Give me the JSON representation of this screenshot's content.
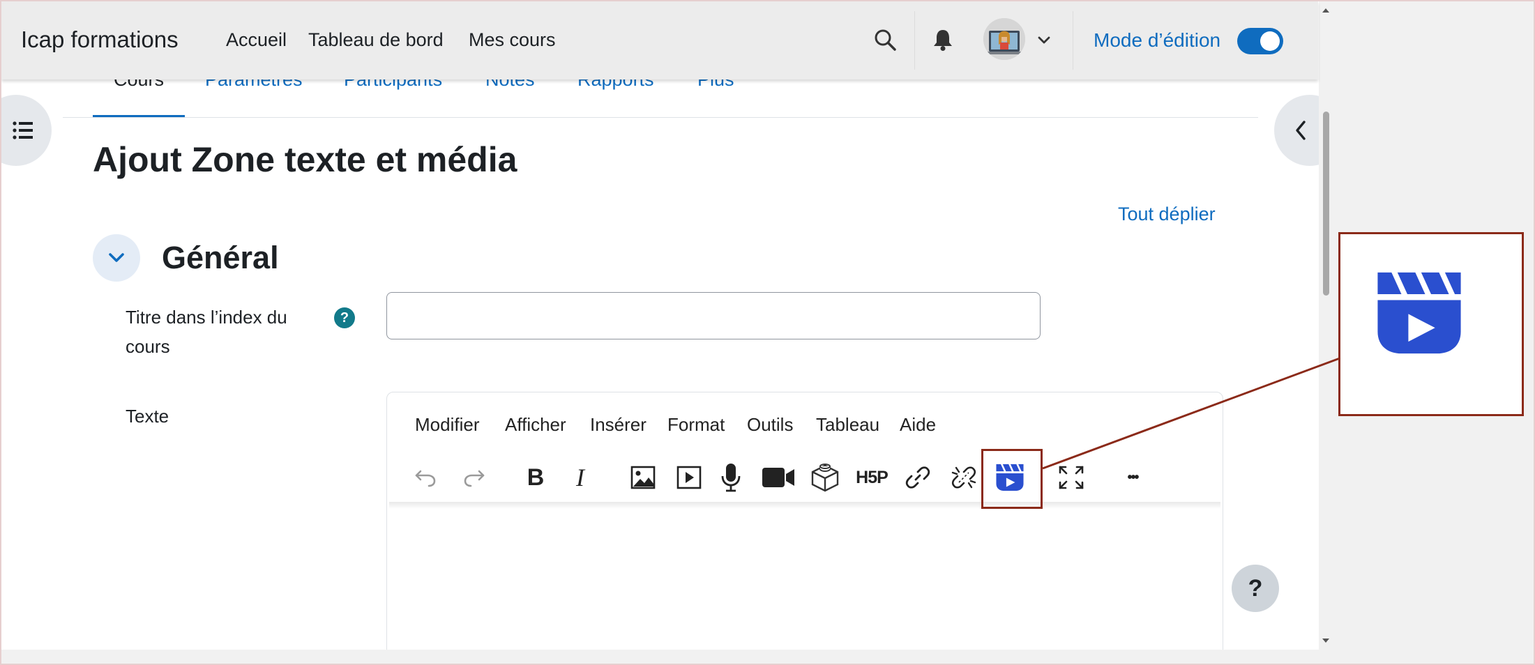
{
  "navbar": {
    "brand": "Icap formations",
    "links": [
      "Accueil",
      "Tableau de bord",
      "Mes cours"
    ],
    "edit_mode_label": "Mode d’édition",
    "edit_mode_on": true
  },
  "tabs": [
    "Cours",
    "Paramètres",
    "Participants",
    "Notes",
    "Rapports",
    "Plus"
  ],
  "page": {
    "title": "Ajout Zone texte et média",
    "expand_all": "Tout déplier",
    "section_title": "Général"
  },
  "form": {
    "title_label": "Titre dans l’index du cours",
    "title_label_line1": "Titre dans l’index du",
    "title_label_line2": "cours",
    "title_value": "",
    "help_icon_text": "?",
    "text_label": "Texte"
  },
  "editor": {
    "menu": [
      "Modifier",
      "Afficher",
      "Insérer",
      "Format",
      "Outils",
      "Tableau",
      "Aide"
    ],
    "toolbar": [
      "undo-icon",
      "redo-icon",
      "bold-icon",
      "italic-icon",
      "image-icon",
      "media-icon",
      "record-audio-icon",
      "record-video-icon",
      "h5p-content-icon",
      "h5p-icon",
      "link-icon",
      "unlink-icon",
      "clapperboard-play-icon",
      "fullscreen-icon",
      "more-icon"
    ],
    "bold_glyph": "B",
    "italic_glyph": "I",
    "h5p_text": "H5P",
    "more_glyph": "•••"
  },
  "help_button": "?",
  "colors": {
    "primary": "#0f6cbf",
    "highlight_border": "#8b2a19",
    "clapper_blue": "#2a4fcf",
    "help_icon": "#127a8a"
  }
}
